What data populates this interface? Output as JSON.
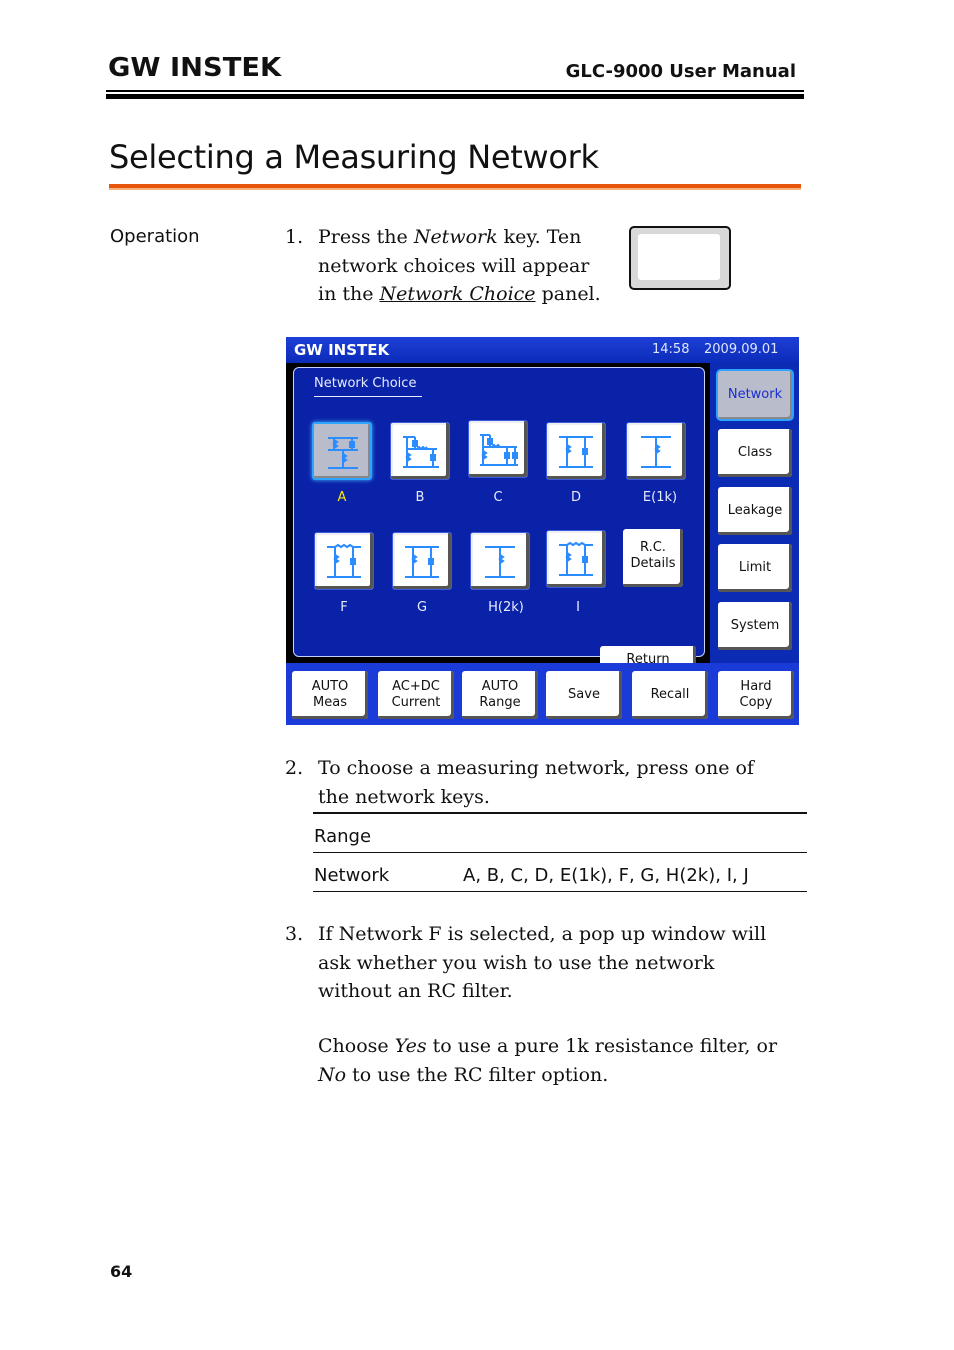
{
  "header": {
    "brand": "GW INSTEK",
    "manual_title": "GLC-9000 User Manual"
  },
  "page_title": "Selecting a Measuring Network",
  "side_label": "Operation",
  "steps": [
    {
      "num": "1.",
      "lines": [
        "Press the ",
        "Network",
        " key. Ten",
        "network choices will appear",
        "in the ",
        "Network Choice",
        " panel."
      ]
    },
    {
      "num": "2.",
      "lines": [
        "To choose a measuring network, press one of",
        "the network keys."
      ]
    },
    {
      "num": "3.",
      "lines": [
        "If Network F is selected, a pop up window will",
        "ask whether you wish to use the network",
        "without an RC filter."
      ],
      "para2": [
        "Choose ",
        "Yes",
        " to use a pure 1k resistance filter, or",
        "No",
        " to use the RC filter option."
      ]
    }
  ],
  "screen": {
    "brand": "GW INSTEK",
    "time": "14:58",
    "date": "2009.09.01",
    "panel_title": "Network Choice",
    "networks": [
      {
        "label": "A",
        "selected": true
      },
      {
        "label": "B",
        "selected": false
      },
      {
        "label": "C",
        "selected": false
      },
      {
        "label": "D",
        "selected": false
      },
      {
        "label": "E(1k)",
        "selected": false
      },
      {
        "label": "F",
        "selected": false
      },
      {
        "label": "G",
        "selected": false
      },
      {
        "label": "H(2k)",
        "selected": false
      },
      {
        "label": "I",
        "selected": false
      }
    ],
    "rc_details": "R.C.\nDetails",
    "return": "Return",
    "side_buttons": [
      {
        "label": "Network",
        "selected": true
      },
      {
        "label": "Class",
        "selected": false
      },
      {
        "label": "Leakage",
        "selected": false
      },
      {
        "label": "Limit",
        "selected": false
      },
      {
        "label": "System",
        "selected": false
      }
    ],
    "bottom_buttons": [
      "AUTO\nMeas",
      "AC+DC\nCurrent",
      "AUTO\nRange",
      "Save",
      "Recall",
      "Hard\nCopy"
    ],
    "colors": {
      "screen_bg": "#0a22a8",
      "icon_line": "#2b8cff",
      "selected_label": "#ffe600",
      "selected_glow": "#2ea3ff"
    }
  },
  "table": {
    "header": "Range",
    "rows": [
      {
        "label": "Network",
        "value": "A, B, C, D, E(1k), F, G, H(2k), I, J"
      }
    ]
  },
  "page_number": "64",
  "colors": {
    "title_rule": "#e8560c"
  }
}
